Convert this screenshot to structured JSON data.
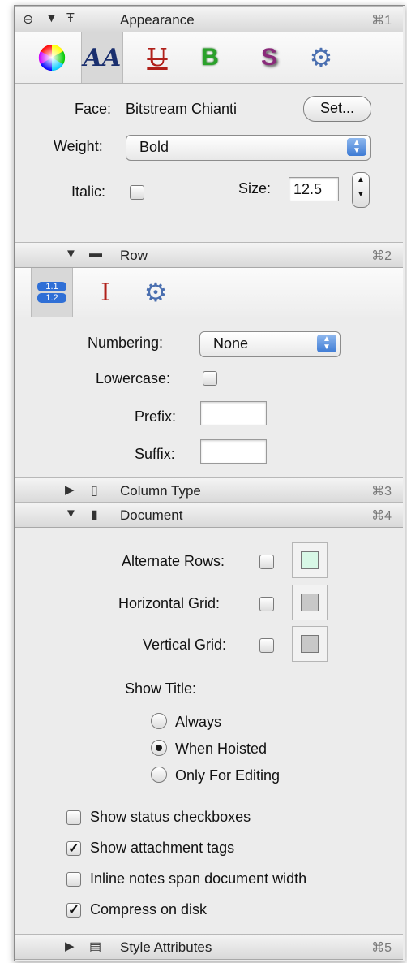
{
  "appearance": {
    "title": "Appearance",
    "shortcut": "⌘1",
    "face_label": "Face:",
    "face_value": "Bitstream Chianti",
    "set_button": "Set...",
    "weight_label": "Weight:",
    "weight_value": "Bold",
    "italic_label": "Italic:",
    "size_label": "Size:",
    "size_value": "12.5"
  },
  "row": {
    "title": "Row",
    "shortcut": "⌘2",
    "numbering_label": "Numbering:",
    "numbering_value": "None",
    "lowercase_label": "Lowercase:",
    "prefix_label": "Prefix:",
    "suffix_label": "Suffix:",
    "icon_numbers": [
      "1.1",
      "1.2"
    ]
  },
  "column_type": {
    "title": "Column Type",
    "shortcut": "⌘3"
  },
  "document": {
    "title": "Document",
    "shortcut": "⌘4",
    "alternate_rows_label": "Alternate Rows:",
    "horizontal_grid_label": "Horizontal Grid:",
    "vertical_grid_label": "Vertical Grid:",
    "show_title_label": "Show Title:",
    "radio_always": "Always",
    "radio_when_hoisted": "When Hoisted",
    "radio_only_editing": "Only For Editing",
    "show_status_checkboxes": "Show status checkboxes",
    "show_attachment_tags": "Show attachment tags",
    "inline_notes": "Inline notes span document width",
    "compress_on_disk": "Compress on disk",
    "alternate_rows_color": "#d8f8e6",
    "grid_color": "#c8c8c8"
  },
  "style_attributes": {
    "title": "Style Attributes",
    "shortcut": "⌘5"
  }
}
